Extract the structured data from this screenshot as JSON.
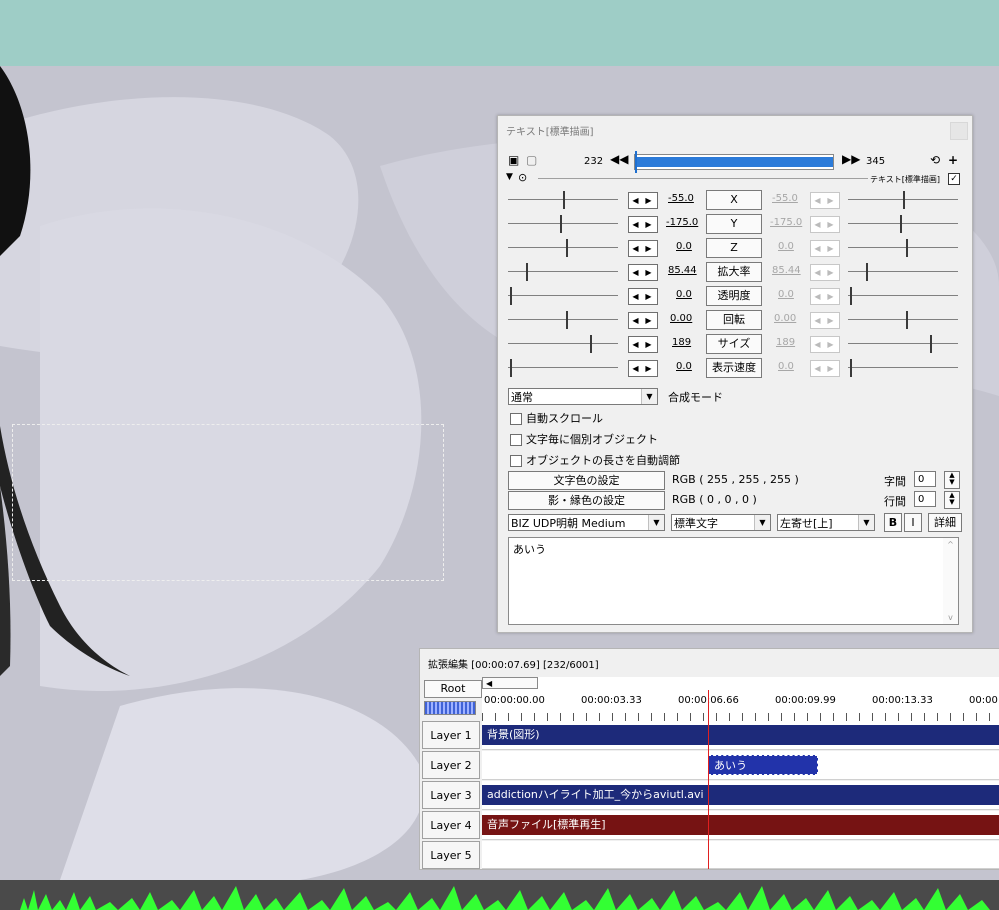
{
  "panel": {
    "title": "テキスト[標準描画]",
    "start_frame": "232",
    "end_frame": "345",
    "object_label": "テキスト[標準描画]",
    "tracks": [
      {
        "label": "X",
        "left_value": "-55.0",
        "right_value": "-55.0"
      },
      {
        "label": "Y",
        "left_value": "-175.0",
        "right_value": "-175.0"
      },
      {
        "label": "Z",
        "left_value": "0.0",
        "right_value": "0.0"
      },
      {
        "label": "拡大率",
        "left_value": "85.44",
        "right_value": "85.44"
      },
      {
        "label": "透明度",
        "left_value": "0.0",
        "right_value": "0.0"
      },
      {
        "label": "回転",
        "left_value": "0.00",
        "right_value": "0.00"
      },
      {
        "label": "サイズ",
        "left_value": "189",
        "right_value": "189"
      },
      {
        "label": "表示速度",
        "left_value": "0.0",
        "right_value": "0.0"
      }
    ],
    "blend_mode_value": "通常",
    "blend_mode_label": "合成モード",
    "checkboxes": [
      "自動スクロール",
      "文字毎に個別オブジェクト",
      "オブジェクトの長さを自動調節"
    ],
    "text_color_button": "文字色の設定",
    "text_color_value": "RGB ( 255 , 255 , 255 )",
    "shadow_color_button": "影・縁色の設定",
    "shadow_color_value": "RGB ( 0 , 0 , 0 )",
    "char_spacing_label": "字間",
    "char_spacing_value": "0",
    "line_spacing_label": "行間",
    "line_spacing_value": "0",
    "font_value": "BIZ UDP明朝 Medium",
    "style_value": "標準文字",
    "align_value": "左寄せ[上]",
    "bold_label": "B",
    "italic_label": "I",
    "detail_label": "詳細",
    "text_content": "あいう"
  },
  "timeline": {
    "title": "拡張編集 [00:00:07.69] [232/6001]",
    "root_label": "Root",
    "time_labels": [
      "00:00:00.00",
      "00:00:03.33",
      "00:00:06.66",
      "00:00:09.99",
      "00:00:13.33",
      "00:00:"
    ],
    "layers": [
      "Layer 1",
      "Layer 2",
      "Layer 3",
      "Layer 4",
      "Layer 5"
    ],
    "clips": {
      "layer1": "背景(図形)",
      "layer2": "あいう",
      "layer3": "addictionハイライト加工_今からaviutl.avi",
      "layer4": "音声ファイル[標準再生]"
    }
  },
  "colors": {
    "topbar": "#9ecdc6",
    "clip_blue": "#1d2a7a",
    "clip_text": "#2233aa",
    "clip_red": "#761313",
    "waveform": "#33ff33",
    "cursor": "#e02020",
    "seek_fill": "#2c7bd9"
  }
}
